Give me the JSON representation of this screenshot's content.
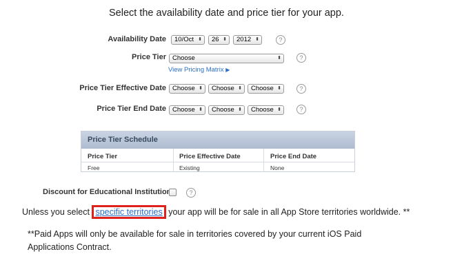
{
  "heading": "Select the availability date and price tier for your app.",
  "availability": {
    "label": "Availability Date",
    "month": "10/Oct",
    "day": "26",
    "year": "2012"
  },
  "price_tier": {
    "label": "Price Tier",
    "value": "Choose",
    "matrix_link": "View Pricing Matrix",
    "matrix_arrow": "▶"
  },
  "effective": {
    "label": "Price Tier Effective Date",
    "month": "Choose",
    "day": "Choose",
    "year": "Choose"
  },
  "end": {
    "label": "Price Tier End Date",
    "month": "Choose",
    "day": "Choose",
    "year": "Choose"
  },
  "help_glyph": "?",
  "select_arrow": "⬍",
  "schedule": {
    "title": "Price Tier Schedule",
    "columns": [
      "Price Tier",
      "Price Effective Date",
      "Price End Date"
    ],
    "rows": [
      [
        "Free",
        "Existing",
        "None"
      ]
    ]
  },
  "discount": {
    "label": "Discount for Educational Institutions",
    "checked": false
  },
  "territories": {
    "before": "Unless you select",
    "link": "specific territories",
    "after": "your app will be for sale in all App Store territories worldwide. **"
  },
  "note": {
    "line1": "**Paid Apps will only be available for sale in territories covered by your current iOS Paid",
    "line2": "Applications Contract."
  }
}
